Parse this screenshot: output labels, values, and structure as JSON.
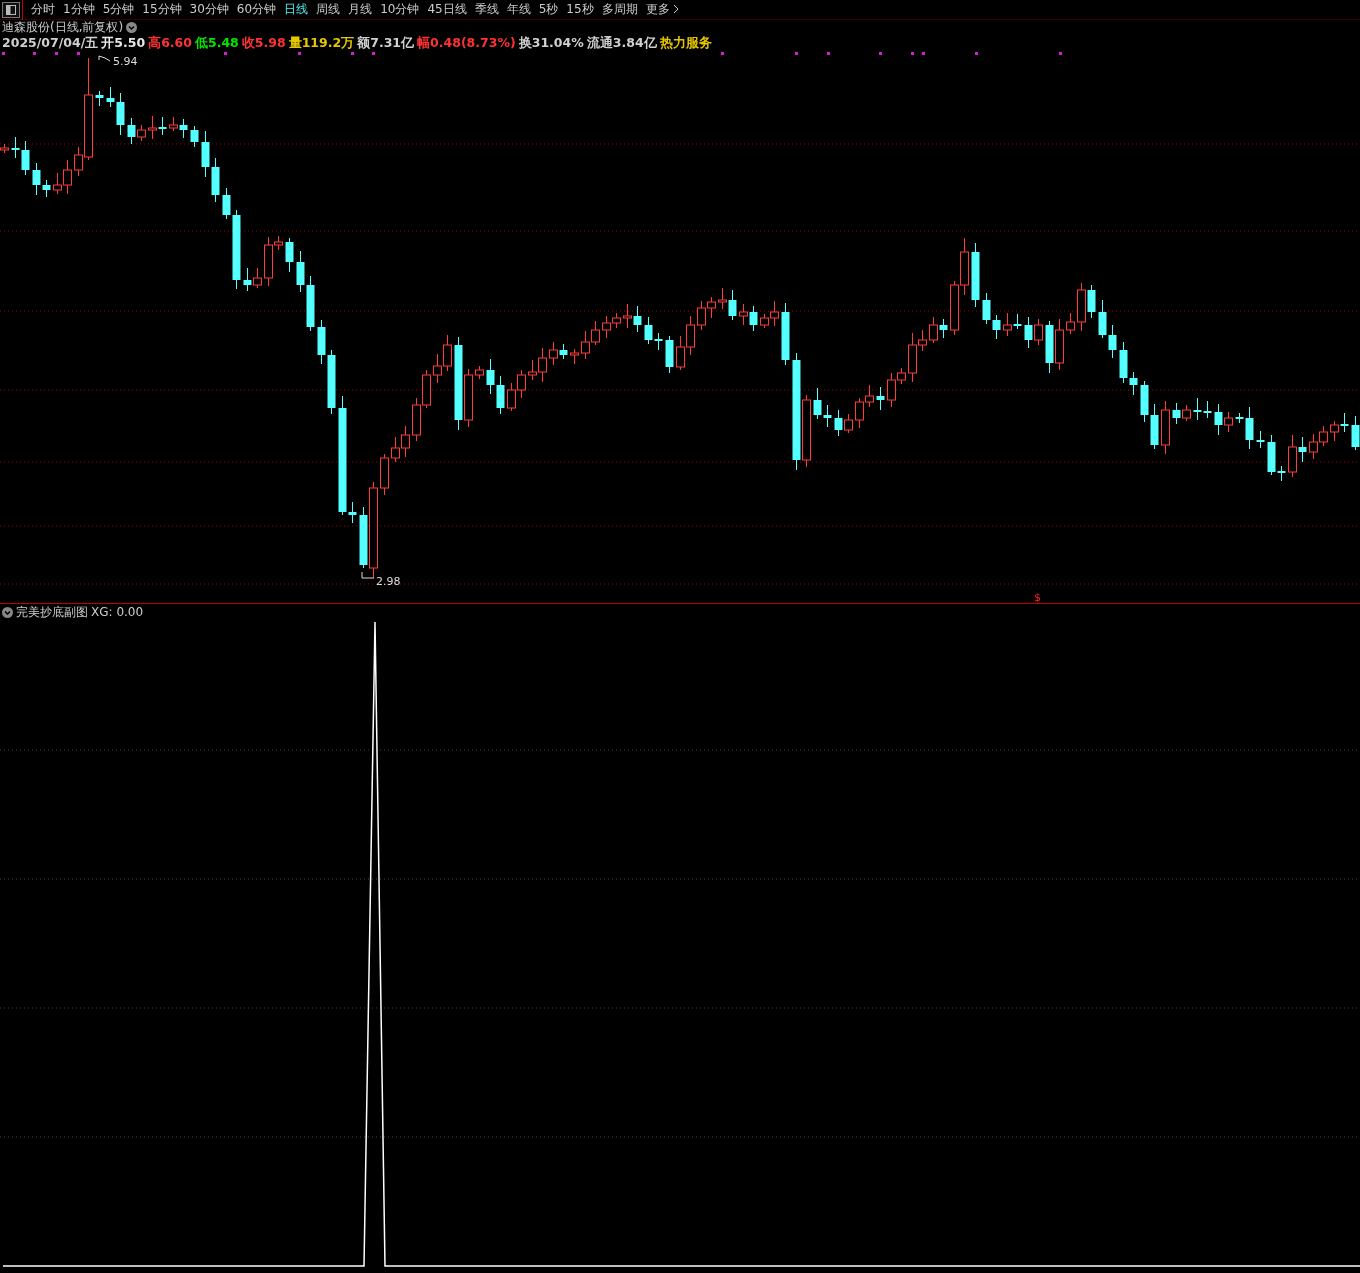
{
  "toolbar": {
    "tabs": [
      {
        "label": "分时",
        "selected": false
      },
      {
        "label": "1分钟",
        "selected": false
      },
      {
        "label": "5分钟",
        "selected": false
      },
      {
        "label": "15分钟",
        "selected": false
      },
      {
        "label": "30分钟",
        "selected": false
      },
      {
        "label": "60分钟",
        "selected": false
      },
      {
        "label": "日线",
        "selected": true
      },
      {
        "label": "周线",
        "selected": false
      },
      {
        "label": "月线",
        "selected": false
      },
      {
        "label": "10分钟",
        "selected": false
      },
      {
        "label": "45日线",
        "selected": false
      },
      {
        "label": "季线",
        "selected": false
      },
      {
        "label": "年线",
        "selected": false
      },
      {
        "label": "5秒",
        "selected": false
      },
      {
        "label": "15秒",
        "selected": false
      },
      {
        "label": "多周期",
        "selected": false
      },
      {
        "label": "更多",
        "selected": false
      }
    ]
  },
  "main_chart": {
    "title": "迪森股份(日线,前复权)",
    "info": [
      {
        "text": "2025/07/04/五",
        "color": "#d0d0d0"
      },
      {
        "text": "开5.50",
        "color": "#e8e8e8"
      },
      {
        "text": "高6.60",
        "color": "#ff3232"
      },
      {
        "text": "低5.48",
        "color": "#00e600"
      },
      {
        "text": "收5.98",
        "color": "#ff3232"
      },
      {
        "text": "量119.2万",
        "color": "#e6c800"
      },
      {
        "text": "额7.31亿",
        "color": "#d0d0d0"
      },
      {
        "text": "幅0.48(8.73%)",
        "color": "#ff3232"
      },
      {
        "text": "换31.04%",
        "color": "#d0d0d0"
      },
      {
        "text": "流通3.84亿",
        "color": "#d0d0d0"
      },
      {
        "text": "热力服务",
        "color": "#e6c800"
      }
    ],
    "max_label": "5.94",
    "min_label": "2.98",
    "signal_mark": "$"
  },
  "sub_chart": {
    "title": "完美抄底副图",
    "reading": "XG: 0.00"
  }
}
